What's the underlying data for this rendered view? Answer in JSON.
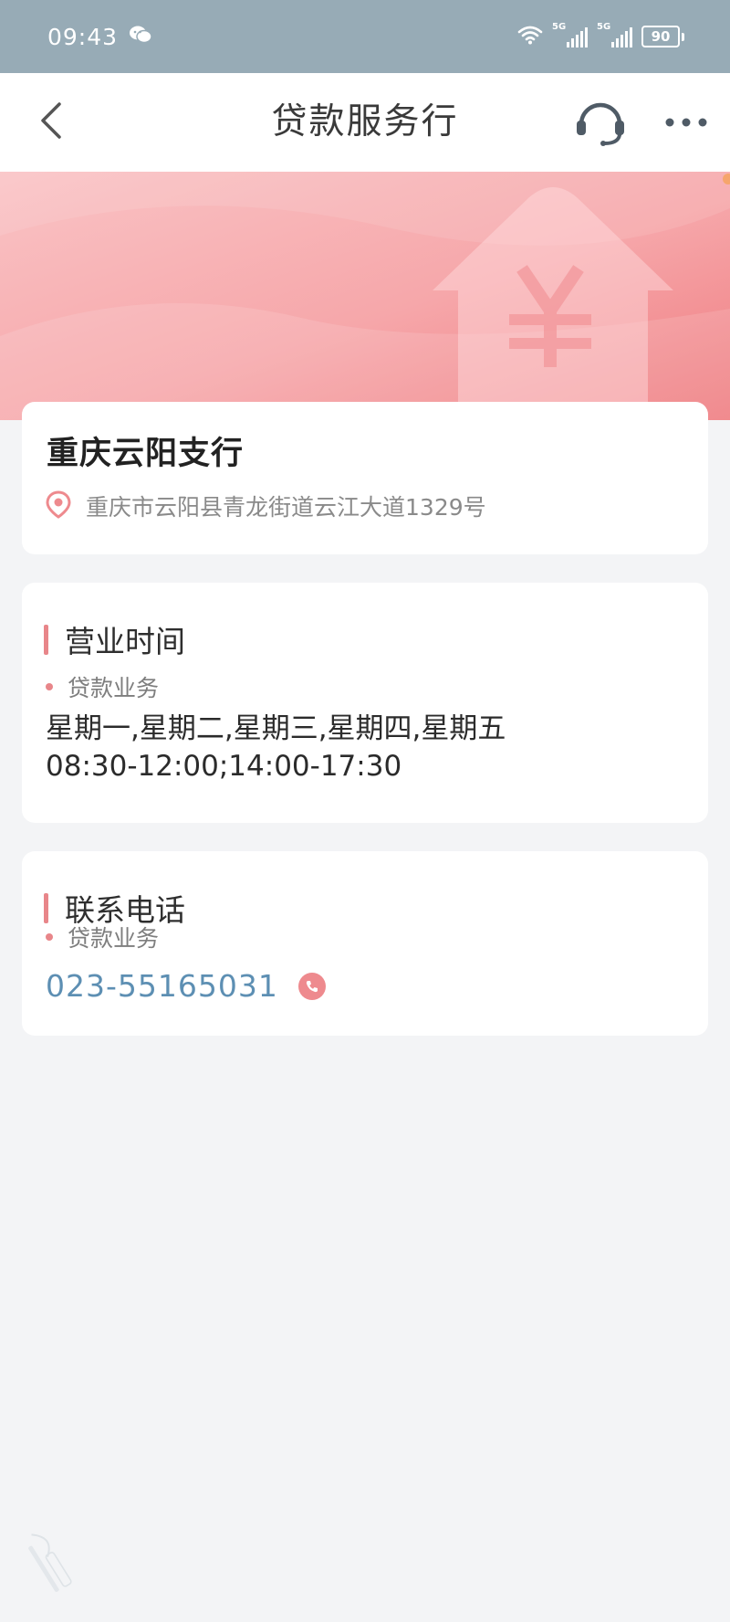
{
  "status_bar": {
    "time": "09:43",
    "network_1": "5G",
    "network_2": "5G",
    "battery": "90"
  },
  "header": {
    "title": "贷款服务行"
  },
  "branch": {
    "name": "重庆云阳支行",
    "address": "重庆市云阳县青龙街道云江大道1329号"
  },
  "hours": {
    "title": "营业时间",
    "service": "贷款业务",
    "days": "星期一,星期二,星期三,星期四,星期五",
    "times": "08:30-12:00;14:00-17:30"
  },
  "contact": {
    "title": "联系电话",
    "service": "贷款业务",
    "phone": "023-55165031"
  },
  "colors": {
    "status_bar": "#97ABB6",
    "accent": "#E8868A",
    "link": "#5D8FB3",
    "background": "#F3F4F6"
  },
  "icons": {
    "status": [
      "wechat-icon",
      "wifi-icon",
      "signal-icon",
      "battery-icon"
    ],
    "nav": [
      "back-icon",
      "headset-icon",
      "more-icon"
    ],
    "content": [
      "location-pin-icon",
      "phone-icon"
    ]
  }
}
